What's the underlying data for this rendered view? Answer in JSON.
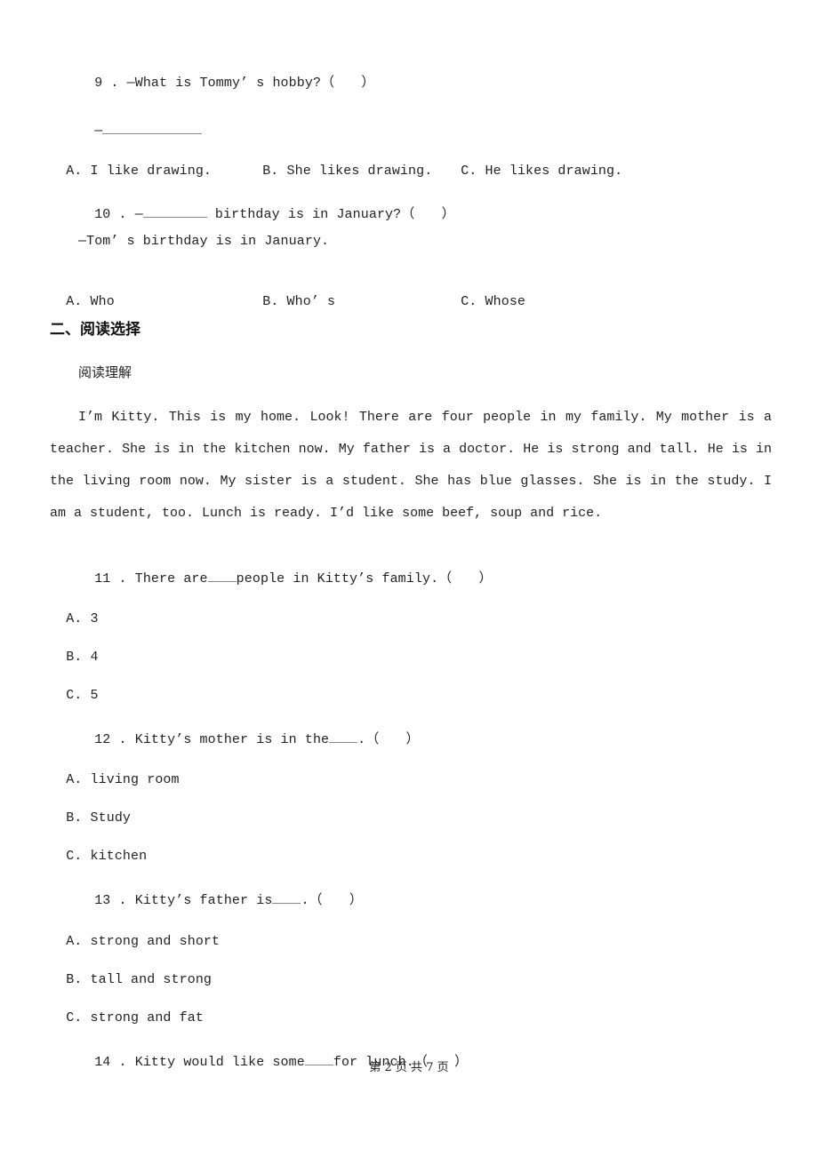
{
  "questions_part1": [
    {
      "number": "9",
      "prompt": "—What is Tommy’ s hobby?（　　）",
      "answer_prefix": "—",
      "options": [
        {
          "letter": "A.",
          "text": "I like drawing."
        },
        {
          "letter": "B.",
          "text": "She likes drawing."
        },
        {
          "letter": "C.",
          "text": "He likes drawing."
        }
      ]
    },
    {
      "number": "10",
      "prompt_prefix": "—",
      "prompt_suffix": " birthday is in January?（　　）",
      "reply": "—Tom’ s birthday is in January.",
      "options": [
        {
          "letter": "A.",
          "text": "Who"
        },
        {
          "letter": "B.",
          "text": "Who’ s"
        },
        {
          "letter": "C.",
          "text": "Whose"
        }
      ]
    }
  ],
  "section2": {
    "title": "二、阅读选择",
    "subtitle": "阅读理解",
    "passage": "I’m Kitty. This is my home. Look! There are four people in my family. My mother is a teacher. She is in the kitchen now. My father is a doctor. He is strong and tall. He is in the living room now. My sister is a student. She has blue glasses. She is in the study. I am a student, too. Lunch is ready. I’d like some beef, soup and rice.",
    "questions": [
      {
        "number": "11",
        "prompt_before": "There are",
        "prompt_after": "people in Kitty’s family.（　　）",
        "options": [
          {
            "letter": "A.",
            "text": "3"
          },
          {
            "letter": "B.",
            "text": "4"
          },
          {
            "letter": "C.",
            "text": "5"
          }
        ]
      },
      {
        "number": "12",
        "prompt_before": "Kitty’s mother is in the",
        "prompt_after": ".（　　）",
        "options": [
          {
            "letter": "A.",
            "text": "living room"
          },
          {
            "letter": "B.",
            "text": "Study"
          },
          {
            "letter": "C.",
            "text": "kitchen"
          }
        ]
      },
      {
        "number": "13",
        "prompt_before": "Kitty’s father is",
        "prompt_after": ".（　　）",
        "options": [
          {
            "letter": "A.",
            "text": "strong and short"
          },
          {
            "letter": "B.",
            "text": "tall and strong"
          },
          {
            "letter": "C.",
            "text": "strong and fat"
          }
        ]
      },
      {
        "number": "14",
        "prompt_before": "Kitty would like some",
        "prompt_after": "for lunch.（　　）"
      }
    ]
  },
  "footer": {
    "page_label": "第 2 页 共 7 页"
  }
}
